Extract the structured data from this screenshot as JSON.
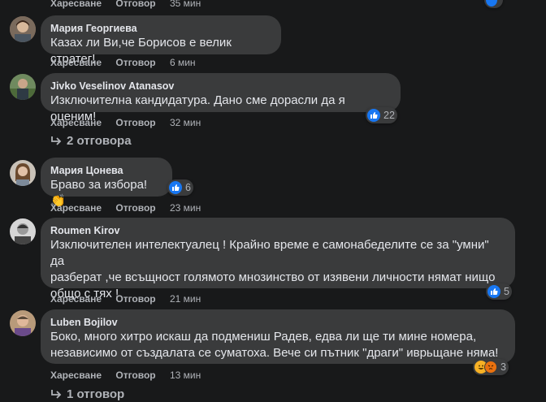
{
  "top": {
    "like": "Харесване",
    "reply": "Отговор",
    "time": "35 мин"
  },
  "comments": [
    {
      "author": "Мария Георгиева",
      "text": "Казах ли Ви,че Борисов е велик стратег!",
      "like": "Харесване",
      "reply": "Отговор",
      "time": "6 мин"
    },
    {
      "author": "Jivko Veselinov Atanasov",
      "text": "Изключителна кандидатура. Дано сме дорасли да я оценим!",
      "like": "Харесване",
      "reply": "Отговор",
      "time": "32 мин",
      "reactions": "22",
      "replies": "2 отговора"
    },
    {
      "author": "Мария Цонева",
      "text": "Браво за избора! 👏",
      "like": "Харесване",
      "reply": "Отговор",
      "time": "23 мин",
      "reactions": "6"
    },
    {
      "author": "Roumen Kirov",
      "text": "Изключителен интелектуалец ! Крайно време е самонабеделите се за \"умни\" да\nразберат ,че всъщност голямото мнозинство от изявени личности нямат нищо\nобщо с тях !",
      "like": "Харесване",
      "reply": "Отговор",
      "time": "21 мин",
      "reactions": "5"
    },
    {
      "author": "Luben Bojilov",
      "text": "Боко, много хитро искаш да подмениш Радев, едва ли ще ти мине номера,\nнезависимо от създалата се суматоха. Вече си пътник \"драги\" иврьщане няма!",
      "like": "Харесване",
      "reply": "Отговор",
      "time": "13 мин",
      "reactions": "3",
      "replies": "1 отговор"
    }
  ],
  "colors": {
    "background": "#18191a",
    "bubble": "#3a3b3c",
    "like_blue": "#1877f2",
    "meta_text": "#b0b3b8"
  },
  "icons": [
    "like-icon",
    "haha-icon",
    "angry-icon",
    "reply-arrow-icon"
  ]
}
